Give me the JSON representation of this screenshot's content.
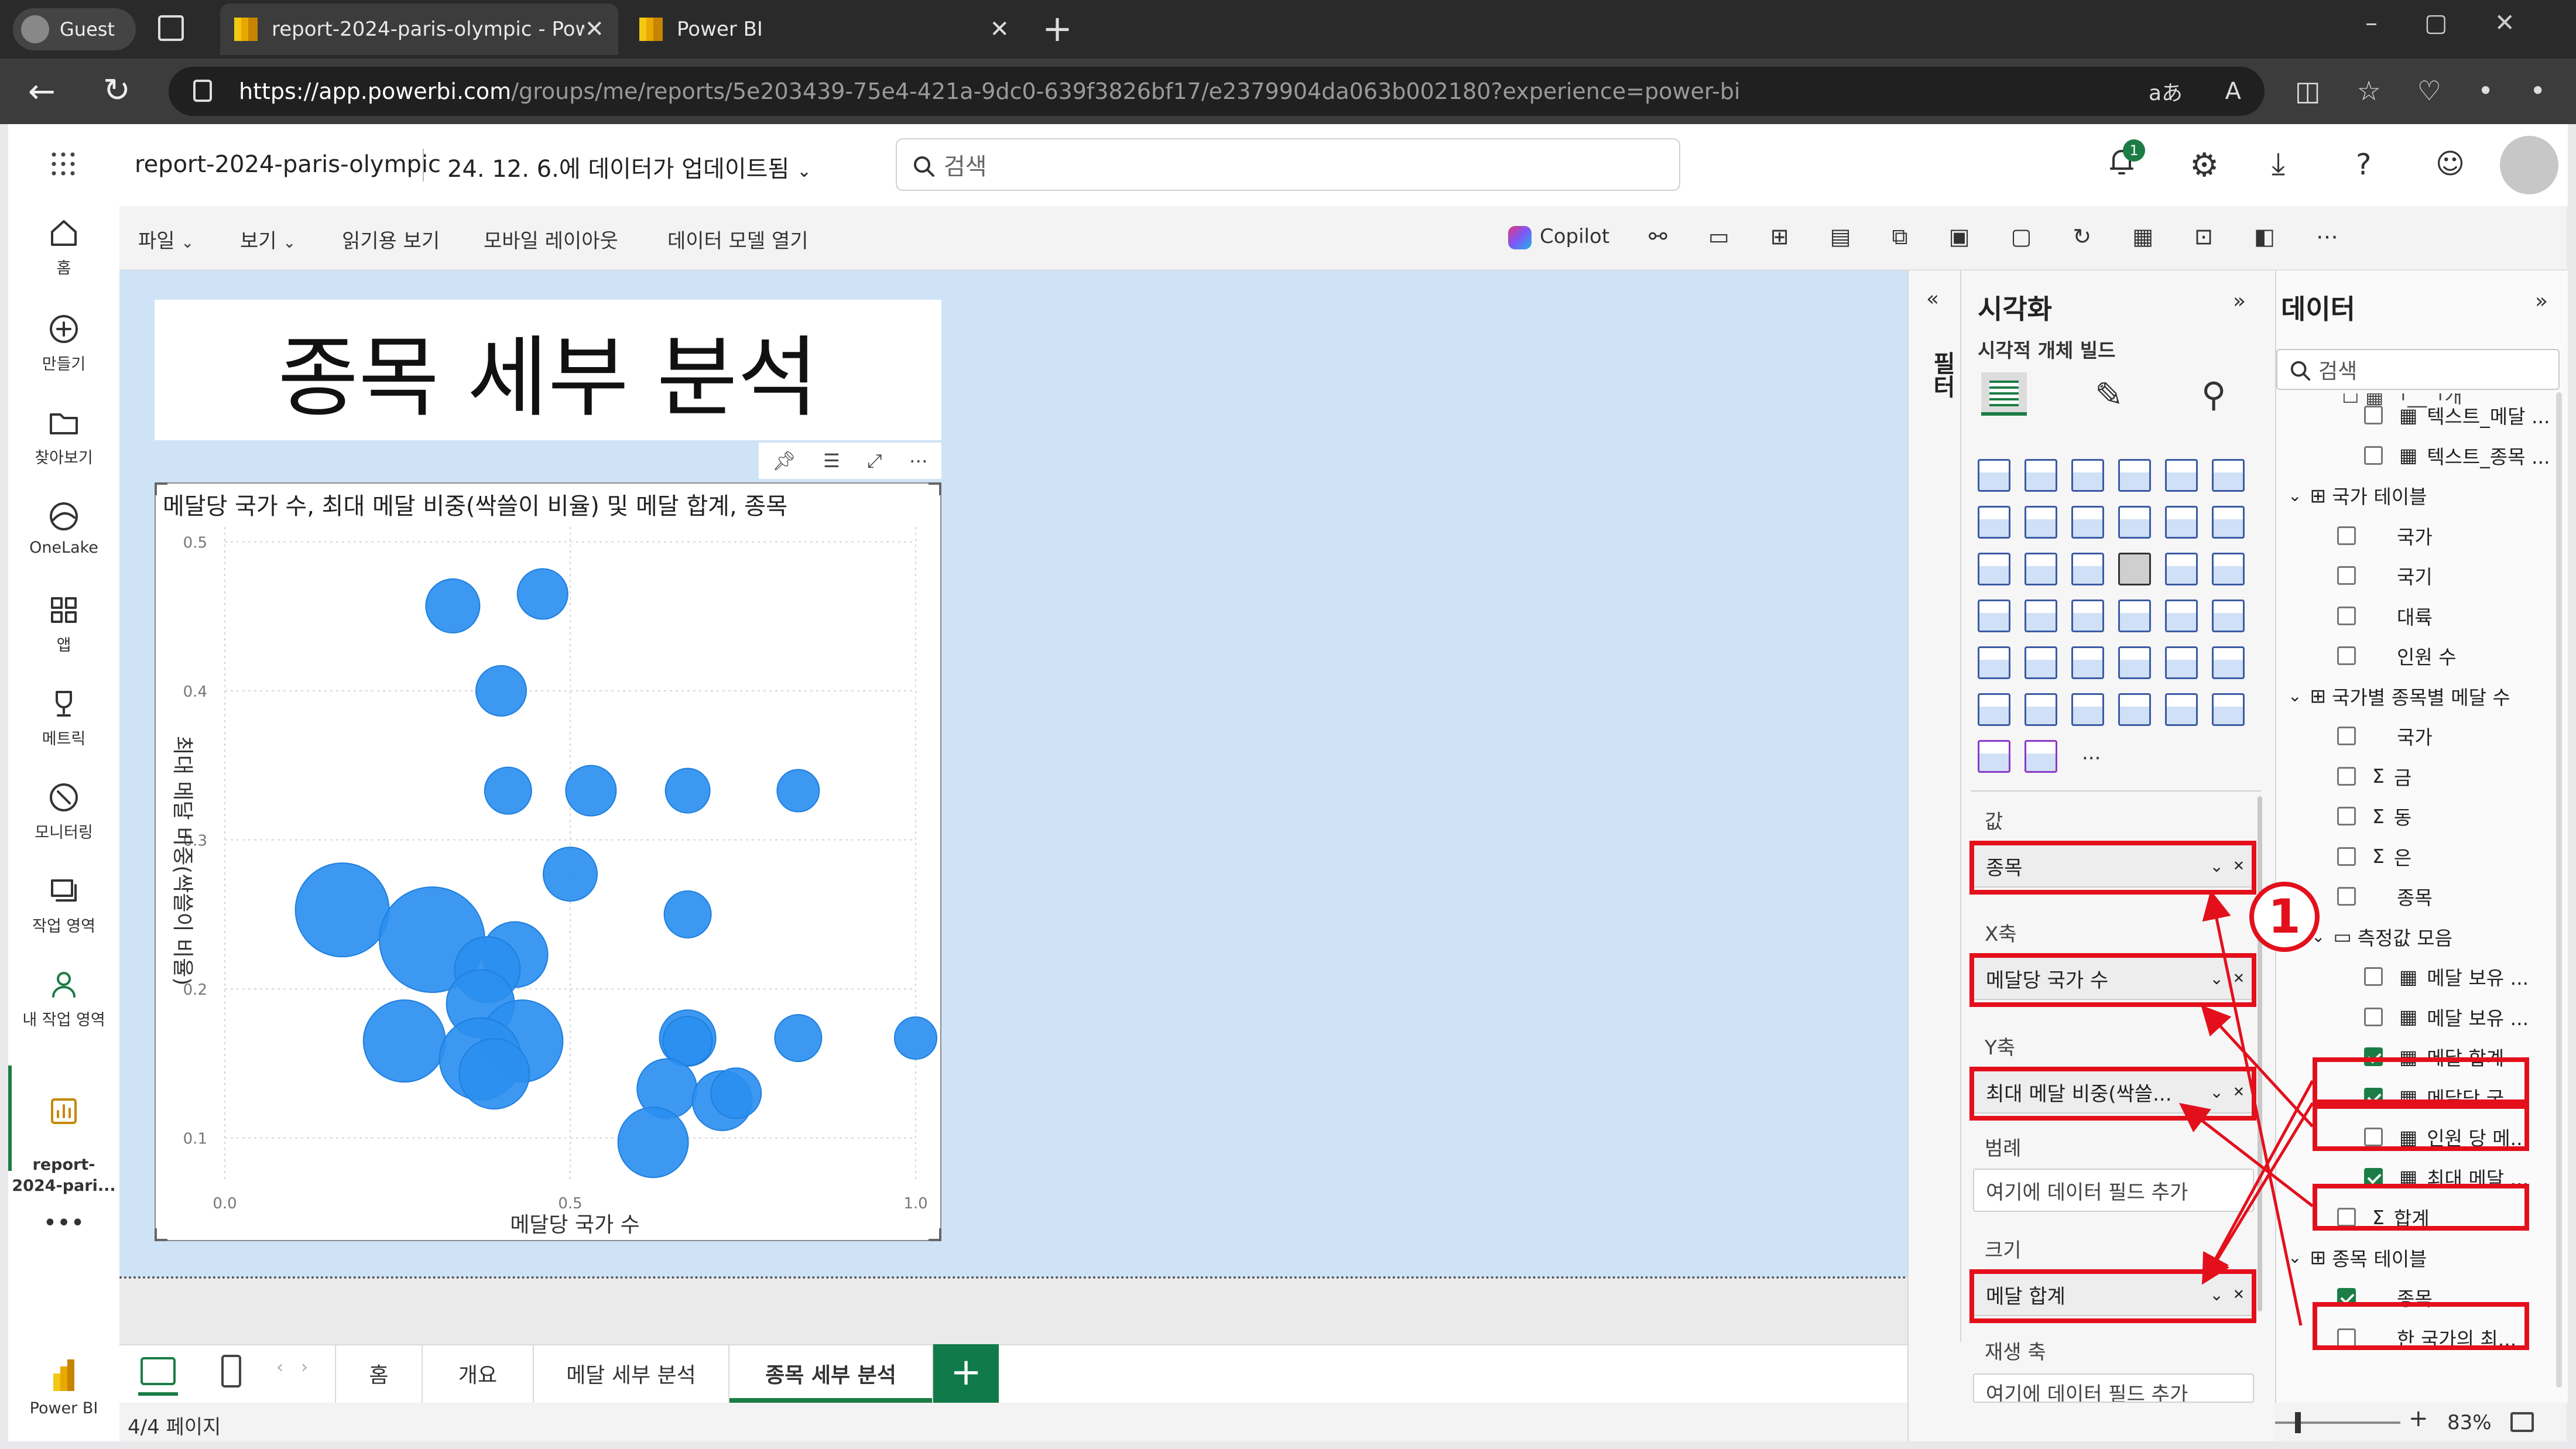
{
  "browser": {
    "guest_label": "Guest",
    "tab1_title": "report-2024-paris-olympic - Powe",
    "tab2_title": "Power BI",
    "url_host": "https://app.powerbi.com",
    "url_path": "/groups/me/reports/5e203439-75e4-421a-9dc0-639f3826bf17/e2379904da063b002180?experience=power-bi",
    "reader_label": "aあ"
  },
  "header": {
    "report_name": "report-2024-paris-olympic",
    "updated": "24. 12. 6.에 데이터가 업데이트됨",
    "search_placeholder": "검색",
    "notif_count": "1"
  },
  "leftnav": {
    "items": [
      "홈",
      "만들기",
      "찾아보기",
      "OneLake",
      "앱",
      "메트릭",
      "모니터링",
      "작업 영역",
      "내 작업 영역",
      "report-\n2024-pari..."
    ],
    "more": "•••",
    "powerbi": "Power BI"
  },
  "ribbon": {
    "file": "파일",
    "view": "보기",
    "reading": "읽기용 보기",
    "mobile": "모바일 레이아웃",
    "datamodel": "데이터 모델 열기",
    "copilot": "Copilot"
  },
  "canvas": {
    "title_text": "종목 세부 분석"
  },
  "chart_data": {
    "type": "scatter",
    "title": "메달당 국가 수, 최대 메달 비중(싹쓸이 비율) 및 메달 합계, 종목",
    "xlabel": "메달당 국가 수",
    "ylabel": "최대 메달 비중(싹쓸이 비율)",
    "xlim": [
      0,
      1.0
    ],
    "ylim": [
      0.07,
      0.51
    ],
    "x_ticks": [
      "0.0",
      "0.5",
      "1.0"
    ],
    "y_ticks": [
      "0.1",
      "0.2",
      "0.3",
      "0.4",
      "0.5"
    ],
    "color": "#2b8ff0",
    "points": [
      {
        "x": 0.33,
        "y": 0.457,
        "size": 0.28
      },
      {
        "x": 0.46,
        "y": 0.465,
        "size": 0.25
      },
      {
        "x": 0.4,
        "y": 0.4,
        "size": 0.25
      },
      {
        "x": 0.41,
        "y": 0.333,
        "size": 0.22
      },
      {
        "x": 0.53,
        "y": 0.333,
        "size": 0.25
      },
      {
        "x": 0.67,
        "y": 0.333,
        "size": 0.2
      },
      {
        "x": 0.83,
        "y": 0.333,
        "size": 0.18
      },
      {
        "x": 0.5,
        "y": 0.277,
        "size": 0.28
      },
      {
        "x": 0.17,
        "y": 0.253,
        "size": 0.62
      },
      {
        "x": 0.3,
        "y": 0.233,
        "size": 0.72
      },
      {
        "x": 0.67,
        "y": 0.25,
        "size": 0.22
      },
      {
        "x": 0.42,
        "y": 0.223,
        "size": 0.38
      },
      {
        "x": 0.38,
        "y": 0.213,
        "size": 0.38
      },
      {
        "x": 0.37,
        "y": 0.19,
        "size": 0.4
      },
      {
        "x": 0.26,
        "y": 0.165,
        "size": 0.52
      },
      {
        "x": 0.43,
        "y": 0.165,
        "size": 0.52
      },
      {
        "x": 0.37,
        "y": 0.153,
        "size": 0.52
      },
      {
        "x": 0.39,
        "y": 0.143,
        "size": 0.42
      },
      {
        "x": 0.67,
        "y": 0.167,
        "size": 0.3
      },
      {
        "x": 0.67,
        "y": 0.165,
        "size": 0.24
      },
      {
        "x": 0.83,
        "y": 0.167,
        "size": 0.22
      },
      {
        "x": 1.0,
        "y": 0.167,
        "size": 0.18
      },
      {
        "x": 0.64,
        "y": 0.133,
        "size": 0.33
      },
      {
        "x": 0.72,
        "y": 0.125,
        "size": 0.33
      },
      {
        "x": 0.74,
        "y": 0.13,
        "size": 0.25
      },
      {
        "x": 0.62,
        "y": 0.097,
        "size": 0.42
      }
    ]
  },
  "pages": {
    "tabs": [
      "홈",
      "개요",
      "메달 세부 분석",
      "종목 세부 분석"
    ],
    "active": 3,
    "add": "+",
    "page_count": "4/4 페이지",
    "zoom": "83%"
  },
  "visual_pane": {
    "filter_label": "필터",
    "title": "시각화",
    "build_label": "시각적 개체 빌드",
    "value_label": "값",
    "value_field": "종목",
    "x_label": "X축",
    "x_field": "메달당 국가 수",
    "y_label": "Y축",
    "y_field": "최대 메달 비중(싹쓸...",
    "legend_label": "범례",
    "legend_placeholder": "여기에 데이터 필드 추가",
    "size_label": "크기",
    "size_field": "메달 합계",
    "play_label": "재생 축",
    "play_placeholder": "여기에 데이터 필드 추가",
    "more_visuals": "..."
  },
  "data_pane": {
    "title": "데이터",
    "search_placeholder": "검색",
    "rows": [
      {
        "indent": 2,
        "kind": "calc",
        "label": "텍스트_메달 ...",
        "checked": false
      },
      {
        "indent": 2,
        "kind": "calc",
        "label": "텍스트_종목 ...",
        "checked": false
      },
      {
        "indent": 0,
        "kind": "table",
        "label": "국가 테이블",
        "checked": null
      },
      {
        "indent": 1,
        "kind": "field",
        "label": "국가",
        "checked": false
      },
      {
        "indent": 1,
        "kind": "field",
        "label": "국기",
        "checked": false
      },
      {
        "indent": 1,
        "kind": "field",
        "label": "대륙",
        "checked": false
      },
      {
        "indent": 1,
        "kind": "field",
        "label": "인원 수",
        "checked": false
      },
      {
        "indent": 0,
        "kind": "table",
        "label": "국가별 종목별 메달 수",
        "checked": null
      },
      {
        "indent": 1,
        "kind": "field",
        "label": "국가",
        "checked": false
      },
      {
        "indent": 1,
        "kind": "sum",
        "label": "금",
        "checked": false
      },
      {
        "indent": 1,
        "kind": "sum",
        "label": "동",
        "checked": false
      },
      {
        "indent": 1,
        "kind": "sum",
        "label": "은",
        "checked": false
      },
      {
        "indent": 1,
        "kind": "field",
        "label": "종목",
        "checked": false
      },
      {
        "indent": 1,
        "kind": "folder",
        "label": "측정값 모음",
        "checked": null
      },
      {
        "indent": 2,
        "kind": "calc",
        "label": "메달 보유 ...",
        "checked": false
      },
      {
        "indent": 2,
        "kind": "calc",
        "label": "메달 보유 ...",
        "checked": false
      },
      {
        "indent": 2,
        "kind": "calc",
        "label": "메달 합계",
        "checked": true
      },
      {
        "indent": 2,
        "kind": "calc",
        "label": "메달당 국...",
        "checked": true
      },
      {
        "indent": 2,
        "kind": "calc",
        "label": "인원 당 메...",
        "checked": false
      },
      {
        "indent": 2,
        "kind": "calc",
        "label": "최대 메달 ...",
        "checked": true
      },
      {
        "indent": 1,
        "kind": "sum",
        "label": "합계",
        "checked": false
      },
      {
        "indent": 0,
        "kind": "table",
        "label": "종목 테이블",
        "checked": null
      },
      {
        "indent": 1,
        "kind": "field",
        "label": "종목",
        "checked": true
      },
      {
        "indent": 1,
        "kind": "field",
        "label": "한 국가의 최...",
        "checked": false
      }
    ]
  },
  "annotation": {
    "marker": "1"
  }
}
